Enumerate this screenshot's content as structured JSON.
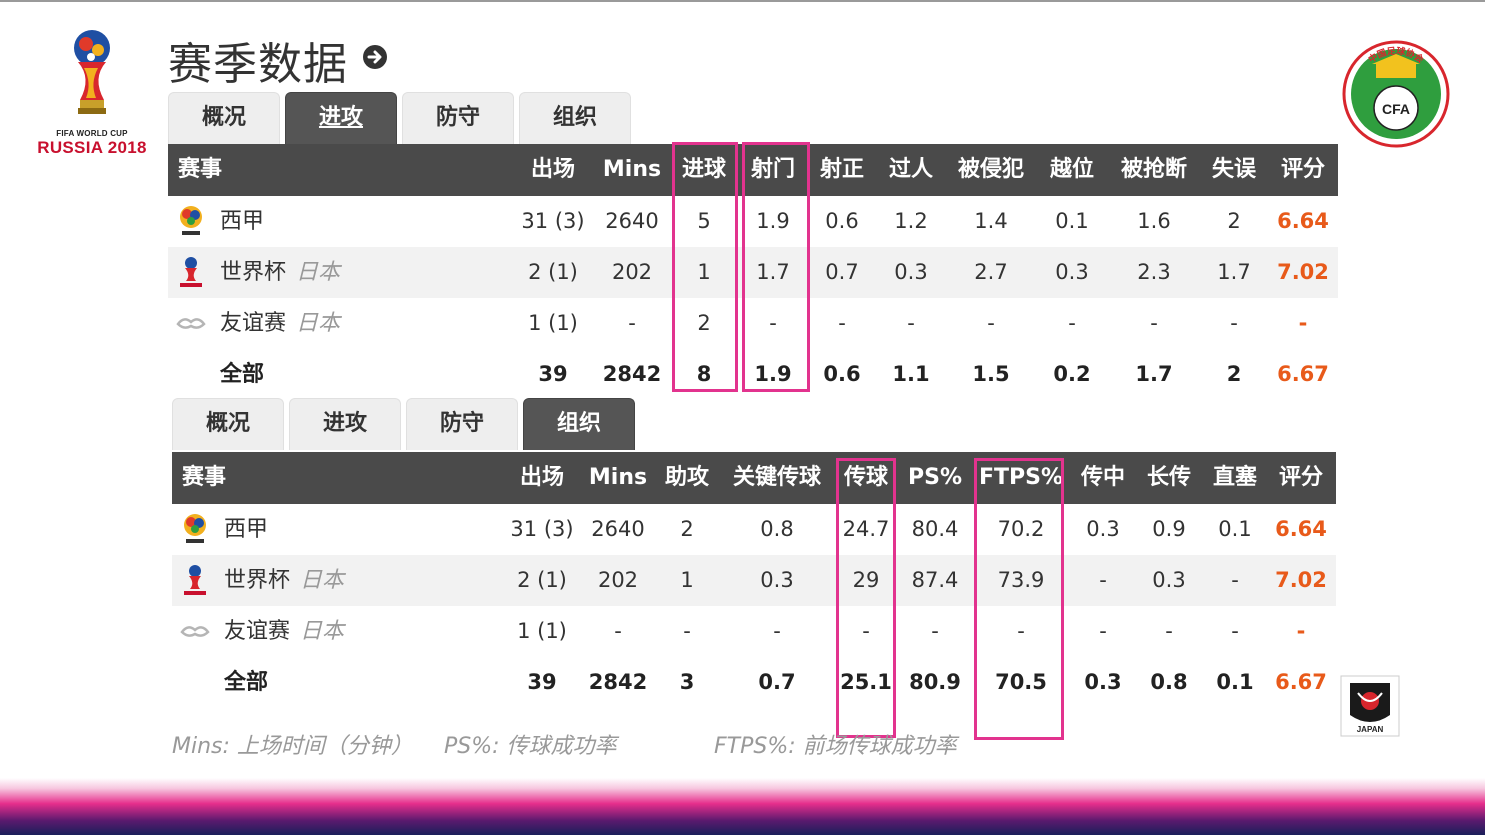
{
  "page": {
    "title": "赛季数据"
  },
  "logos": {
    "wc_line1": "FIFA WORLD CUP",
    "wc_line2": "RUSSIA 2018",
    "cfa_text": "中国足球协会",
    "cfa_ball": "CFA",
    "japan": "JAPAN"
  },
  "attack": {
    "tabs": [
      "概况",
      "进攻",
      "防守",
      "组织"
    ],
    "active_tab": "进攻",
    "headers": [
      "赛事",
      "出场",
      "Mins",
      "进球",
      "射门",
      "射正",
      "过人",
      "被侵犯",
      "越位",
      "被抢断",
      "失误",
      "评分"
    ],
    "rows": [
      {
        "comp": "西甲",
        "opp": "",
        "vals": [
          "31 (3)",
          "2640",
          "5",
          "1.9",
          "0.6",
          "1.2",
          "1.4",
          "0.1",
          "1.6",
          "2",
          "6.64"
        ]
      },
      {
        "comp": "世界杯",
        "opp": "日本",
        "vals": [
          "2 (1)",
          "202",
          "1",
          "1.7",
          "0.7",
          "0.3",
          "2.7",
          "0.3",
          "2.3",
          "1.7",
          "7.02"
        ]
      },
      {
        "comp": "友谊赛",
        "opp": "日本",
        "vals": [
          "1 (1)",
          "-",
          "2",
          "-",
          "-",
          "-",
          "-",
          "-",
          "-",
          "-",
          "-"
        ]
      },
      {
        "comp": "全部",
        "opp": "",
        "vals": [
          "39",
          "2842",
          "8",
          "1.9",
          "0.6",
          "1.1",
          "1.5",
          "0.2",
          "1.7",
          "2",
          "6.67"
        ]
      }
    ]
  },
  "org": {
    "tabs": [
      "概况",
      "进攻",
      "防守",
      "组织"
    ],
    "active_tab": "组织",
    "headers": [
      "赛事",
      "出场",
      "Mins",
      "助攻",
      "关键传球",
      "传球",
      "PS%",
      "FTPS%",
      "传中",
      "长传",
      "直塞",
      "评分"
    ],
    "rows": [
      {
        "comp": "西甲",
        "opp": "",
        "vals": [
          "31 (3)",
          "2640",
          "2",
          "0.8",
          "24.7",
          "80.4",
          "70.2",
          "0.3",
          "0.9",
          "0.1",
          "6.64"
        ]
      },
      {
        "comp": "世界杯",
        "opp": "日本",
        "vals": [
          "2 (1)",
          "202",
          "1",
          "0.3",
          "29",
          "87.4",
          "73.9",
          "-",
          "0.3",
          "-",
          "7.02"
        ]
      },
      {
        "comp": "友谊赛",
        "opp": "日本",
        "vals": [
          "1 (1)",
          "-",
          "-",
          "-",
          "-",
          "-",
          "-",
          "-",
          "-",
          "-",
          "-"
        ]
      },
      {
        "comp": "全部",
        "opp": "",
        "vals": [
          "39",
          "2842",
          "3",
          "0.7",
          "25.1",
          "80.9",
          "70.5",
          "0.3",
          "0.8",
          "0.1",
          "6.67"
        ]
      }
    ]
  },
  "legend": [
    "Mins: 上场时间（分钟）",
    "PS%: 传球成功率",
    "FTPS%: 前场传球成功率"
  ],
  "colors": {
    "header_bg": "#4a4a4a",
    "rating": "#e85a1a",
    "highlight": "#e2338e",
    "tab_active": "#555555"
  }
}
